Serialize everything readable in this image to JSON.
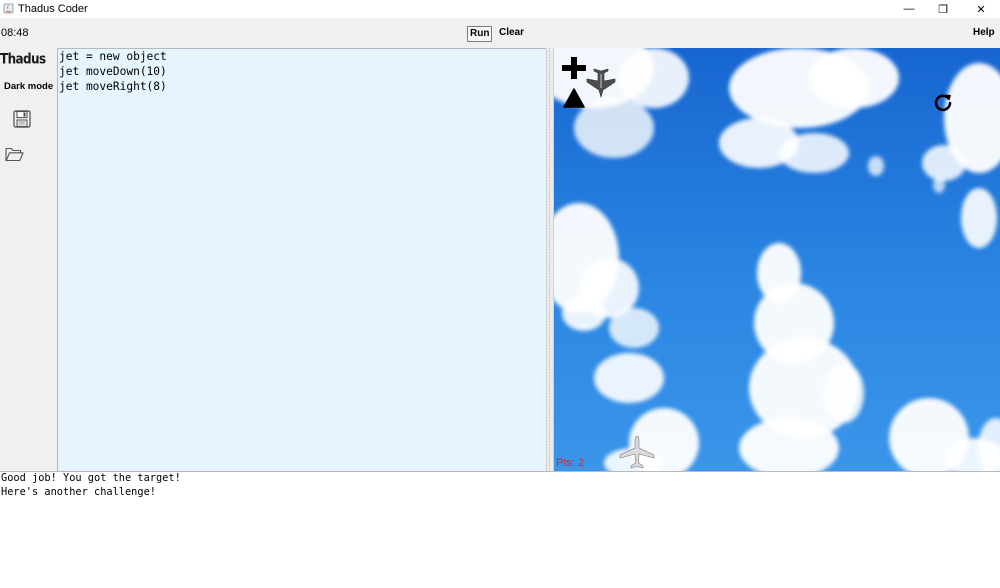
{
  "window": {
    "title": "Thadus Coder",
    "minimize_glyph": "—",
    "restore_glyph": "❐",
    "close_glyph": "✕"
  },
  "toolbar": {
    "clock": "08:48",
    "run_label": "Run",
    "clear_label": "Clear",
    "help_label": "Help"
  },
  "sidebar": {
    "brand": "Thadus",
    "dark_mode_label": "Dark mode",
    "save_icon": "floppy-disk-icon",
    "open_icon": "open-folder-icon"
  },
  "editor": {
    "code": "jet = new object\njet moveDown(10)\njet moveRight(8)"
  },
  "game": {
    "points_label": "Pts: 2",
    "icons": [
      "plus-icon",
      "triangle-icon",
      "fighter-jet-icon",
      "rotate-icon",
      "airliner-icon"
    ],
    "colors": {
      "sky": "#1f73d6",
      "points_text": "#d42a2a"
    }
  },
  "console": {
    "output": "Good job! You got the target!\nHere's another challenge!"
  }
}
